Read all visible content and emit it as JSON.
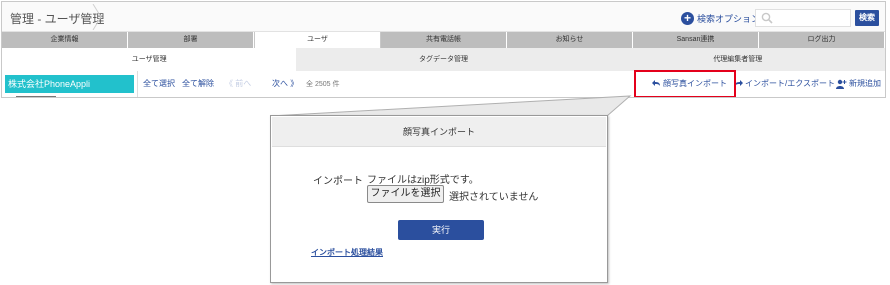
{
  "header": {
    "breadcrumb": "管理 - ユーザ管理",
    "search_option_label": "検索オプション",
    "search_placeholder": "",
    "search_button": "検索"
  },
  "main_tabs": [
    {
      "label": "企業情報",
      "active": false
    },
    {
      "label": "部署",
      "active": false
    },
    {
      "label": "ユーザ",
      "active": true
    },
    {
      "label": "共有電話帳",
      "active": false
    },
    {
      "label": "お知らせ",
      "active": false
    },
    {
      "label": "Sansan連携",
      "active": false
    },
    {
      "label": "ログ出力",
      "active": false
    }
  ],
  "sub_tabs": [
    {
      "label": "ユーザ管理",
      "active": true
    },
    {
      "label": "タグデータ管理",
      "active": false
    },
    {
      "label": "代理編集者管理",
      "active": false
    }
  ],
  "left_panel": {
    "company": "株式会社PhoneAppli"
  },
  "toolbar": {
    "select_all": "全て選択",
    "deselect_all": "全て解除",
    "prev": "《 前へ",
    "next": "次へ 》",
    "count": "全 2505 件",
    "photo_import": "顔写真インポート",
    "import_export": "インポート/エクスポート",
    "add_new": "新規追加"
  },
  "modal": {
    "title": "顔写真インポート",
    "import_label": "インポート",
    "zip_note": "ファイルはzip形式です。",
    "file_button": "ファイルを選択",
    "file_status": "選択されていません",
    "run_button": "実行",
    "result_link": "インポート処理結果"
  },
  "colors": {
    "brand_blue": "#2b4f9e",
    "company_teal": "#22c1cc",
    "highlight_red": "#e4001b"
  },
  "icons": [
    "chevron-right-icon",
    "plus-circle-icon",
    "search-icon",
    "arrow-import-icon",
    "arrow-export-icon",
    "add-user-icon"
  ]
}
